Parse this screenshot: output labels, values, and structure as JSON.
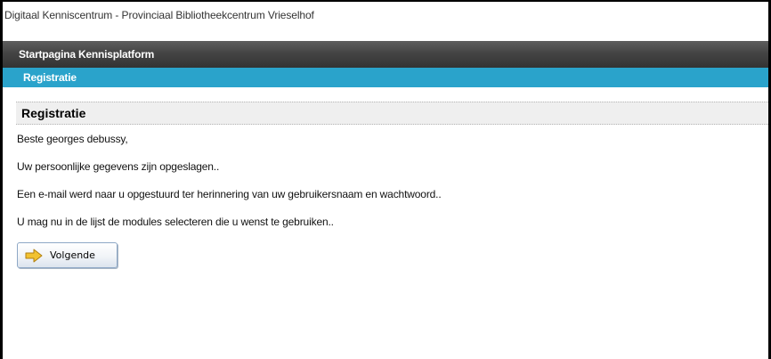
{
  "site": {
    "title": "Digitaal Kenniscentrum - Provinciaal Bibliotheekcentrum Vrieselhof"
  },
  "nav": {
    "primary": "Startpagina Kennisplatform",
    "secondary": "Registratie"
  },
  "main": {
    "section_title": "Registratie",
    "greeting": "Beste georges debussy,",
    "paragraphs": [
      "Uw persoonlijke gegevens zijn opgeslagen..",
      "Een e-mail werd naar u opgestuurd ter herinnering van uw gebruikersnaam en wachtwoord..",
      "U mag nu in de lijst de modules selecteren die u wenst te gebruiken.."
    ],
    "next_button": {
      "label": "Volgende",
      "icon": "arrow-right-icon"
    }
  },
  "colors": {
    "nav_dark": "#444444",
    "nav_blue": "#2aa3cb",
    "arrow_icon": "#f2c230"
  }
}
